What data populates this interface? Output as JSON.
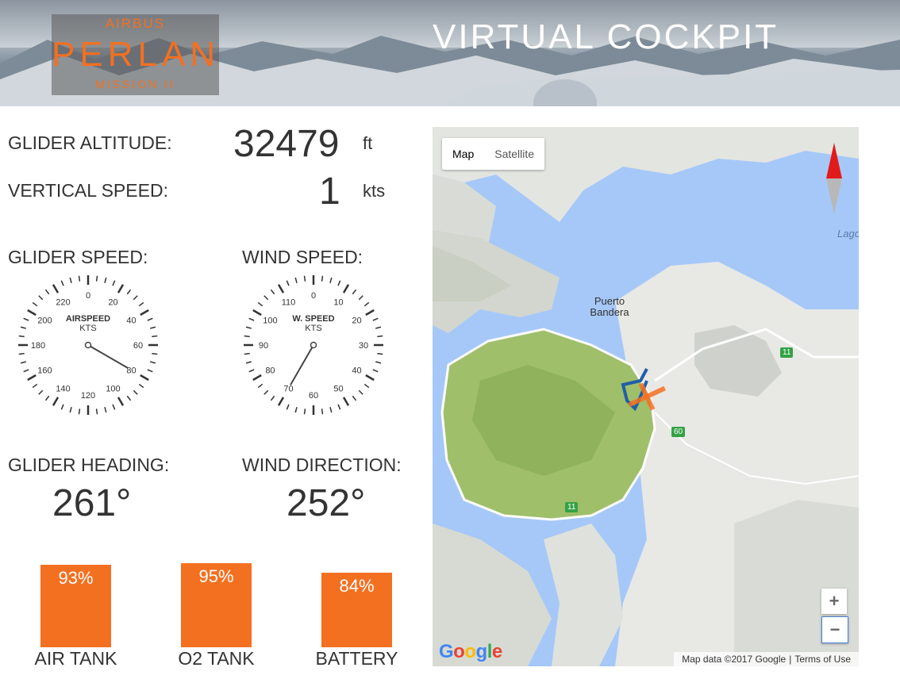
{
  "header": {
    "logo_top": "AIRBUS",
    "logo_main": "PERLAN",
    "logo_sub": "MISSION II",
    "title": "VIRTUAL COCKPIT"
  },
  "readouts": {
    "altitude_label": "GLIDER ALTITUDE:",
    "altitude_value": "32479",
    "altitude_unit": "ft",
    "vertical_label": "VERTICAL SPEED:",
    "vertical_value": "1",
    "vertical_unit": "kts"
  },
  "gauges": {
    "airspeed": {
      "label": "GLIDER SPEED:",
      "dial_title": "AIRSPEED",
      "dial_unit": "KTS",
      "numbers": [
        "0",
        "20",
        "40",
        "60",
        "80",
        "100",
        "120",
        "140",
        "160",
        "180",
        "200",
        "220"
      ],
      "needle_value": 80,
      "max": 240
    },
    "windspeed": {
      "label": "WIND SPEED:",
      "dial_title": "W. SPEED",
      "dial_unit": "KTS",
      "numbers": [
        "0",
        "10",
        "20",
        "30",
        "40",
        "50",
        "60",
        "70",
        "80",
        "90",
        "100",
        "110"
      ],
      "needle_value": 70,
      "max": 120
    }
  },
  "headings": {
    "glider_label": "GLIDER HEADING:",
    "glider_value": "261°",
    "wind_label": "WIND DIRECTION:",
    "wind_value": "252°"
  },
  "levels": [
    {
      "label": "AIR TANK",
      "pct_text": "93%",
      "fraction": 0.93
    },
    {
      "label": "O2 TANK",
      "pct_text": "95%",
      "fraction": 0.95
    },
    {
      "label": "BATTERY",
      "pct_text": "84%",
      "fraction": 0.84
    }
  ],
  "map": {
    "type_map": "Map",
    "type_satellite": "Satellite",
    "place_puerto": "Puerto Bandera",
    "place_lago": "Lago",
    "road_11a": "11",
    "road_11b": "11",
    "road_60": "60",
    "zoom_in": "+",
    "zoom_out": "−",
    "google": "Google",
    "attribution": "Map data ©2017 Google",
    "terms": "Terms of Use"
  },
  "colors": {
    "accent": "#f37021",
    "water": "#a6c8f8",
    "forest": "#9fbf6a",
    "land": "#e8e8e5",
    "track": "#1f5fa8"
  }
}
